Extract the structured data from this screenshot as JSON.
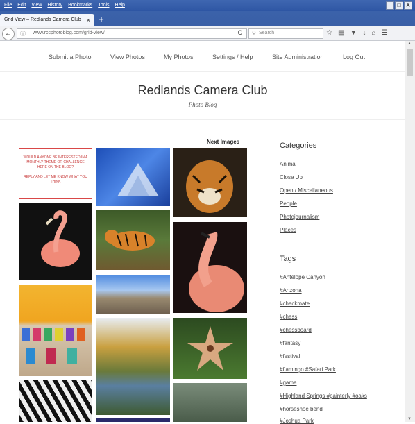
{
  "menubar": {
    "items": [
      "File",
      "Edit",
      "View",
      "History",
      "Bookmarks",
      "Tools",
      "Help"
    ]
  },
  "window_controls": [
    "_",
    "□",
    "X"
  ],
  "tab": {
    "title": "Grid View – Redlands Camera Club",
    "close": "×"
  },
  "newtab": "+",
  "addressbar": {
    "url": "www.rccphotoblog.com/grid-view/",
    "reload": "C",
    "info": "ⓘ"
  },
  "searchbox": {
    "placeholder": "Search"
  },
  "toolbar_icons": [
    "star-icon",
    "clipboard-icon",
    "pocket-icon",
    "download-icon",
    "home-icon",
    "menu-icon"
  ],
  "site_nav": [
    "Submit a Photo",
    "View Photos",
    "My Photos",
    "Settings / Help",
    "Site Administration",
    "Log Out"
  ],
  "site": {
    "title": "Redlands Camera Club",
    "subtitle": "Photo Blog"
  },
  "grid": {
    "next_label": "Next Images",
    "note_line1": "WOULD ANYONE BE INTERESTED IN A MONTHLY THEME OR CHALLENGE HERE ON THE BLOG?",
    "note_line2": "REPLY AND LET ME KNOW WHAT YOU THINK"
  },
  "sidebar": {
    "categories_title": "Categories",
    "categories": [
      "Animal",
      "Close Up",
      "Open / Miscellaneous",
      "People",
      "Photojournalism",
      "Places"
    ],
    "tags_title": "Tags",
    "tags": [
      "#Antelope Canyon",
      "#Arizona",
      "#checkmate",
      "#chess",
      "#chessboard",
      "#fantasy",
      "#festival",
      "#flamingo #Safari Park",
      "#game",
      "#Highland Springs #painterly #oaks",
      "#horseshoe bend",
      "#Joshua Park"
    ]
  }
}
